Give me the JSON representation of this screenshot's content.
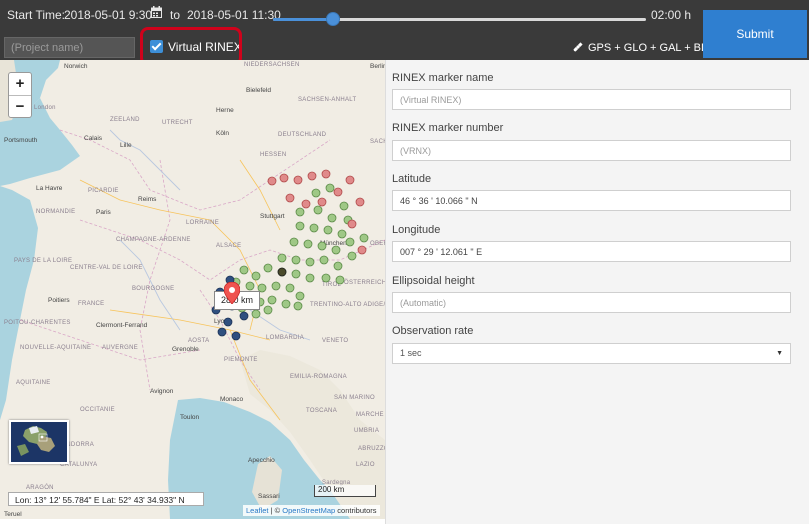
{
  "header": {
    "start_label": "Start Time:",
    "start_value": "2018-05-01 9:30",
    "to_label": "to",
    "end_value": "2018-05-01 11:30",
    "duration": "02:00 h",
    "slider_position": 0.16,
    "project_name_placeholder": "(Project name)",
    "virtual_rinex_label": "Virtual RINEX",
    "virtual_rinex_checked": true,
    "gnss_label": "GPS + GLO + GAL + BDS",
    "submit_label": "Submit",
    "accent": "#2f7fd0"
  },
  "map": {
    "zoom_in": "+",
    "zoom_out": "−",
    "marker_label": "28.0 km",
    "coordinates": "Lon: 13° 12' 55.784\" E Lat: 52° 43' 34.933\" N",
    "scale": "200 km",
    "attribution_leaflet": "Leaflet",
    "attribution_sep": " | © ",
    "attribution_osm": "OpenStreetMap",
    "attribution_rest": " contributors",
    "labels": [
      {
        "t": "Norwich"
      },
      {
        "t": "London"
      },
      {
        "t": "Portsmouth"
      },
      {
        "t": "Calais"
      },
      {
        "t": "Lille"
      },
      {
        "t": "ZEELAND"
      },
      {
        "t": "UTRECHT"
      },
      {
        "t": "Herne"
      },
      {
        "t": "Bielefeld"
      },
      {
        "t": "SACHSEN-ANHALT"
      },
      {
        "t": "Köln"
      },
      {
        "t": "DEUTSCHLAND"
      },
      {
        "t": "HESSEN"
      },
      {
        "t": "Reims"
      },
      {
        "t": "PICARDIE"
      },
      {
        "t": "La Havre"
      },
      {
        "t": "NORMANDIE"
      },
      {
        "t": "Paris"
      },
      {
        "t": "LORRAINE"
      },
      {
        "t": "Stuttgart"
      },
      {
        "t": "CHAMPAGNE-ARDENNE"
      },
      {
        "t": "ALSACE"
      },
      {
        "t": "München"
      },
      {
        "t": "PAYS DE LA LOIRE"
      },
      {
        "t": "CENTRE-VAL DE LOIRE"
      },
      {
        "t": "BOURGOGNE"
      },
      {
        "t": "TIROL"
      },
      {
        "t": "ÖSTERREICH"
      },
      {
        "t": "Poitiers"
      },
      {
        "t": "FRANCE"
      },
      {
        "t": "TRENTINO-ALTO ADIGE/SÜDTIROL"
      },
      {
        "t": "POITOU-CHARENTES"
      },
      {
        "t": "Clermont-Ferrand"
      },
      {
        "t": "Lyon"
      },
      {
        "t": "NOUVELLE-AQUITAINE"
      },
      {
        "t": "AUVERGNE"
      },
      {
        "t": "Grenoble"
      },
      {
        "t": "AOSTA"
      },
      {
        "t": "LOMBARDIA"
      },
      {
        "t": "VENETO"
      },
      {
        "t": "PIEMONTE"
      },
      {
        "t": "EMILIA-ROMAGNA"
      },
      {
        "t": "AQUITAINE"
      },
      {
        "t": "Avignon"
      },
      {
        "t": "Monaco"
      },
      {
        "t": "OCCITANIE"
      },
      {
        "t": "Toulon"
      },
      {
        "t": "TOSCANA"
      },
      {
        "t": "MARCHE"
      },
      {
        "t": "SAN MARINO"
      },
      {
        "t": "ANDORRA"
      },
      {
        "t": "CATALUNYA"
      },
      {
        "t": "ARAGÓN"
      },
      {
        "t": "Apecchio"
      },
      {
        "t": "LAZIO"
      },
      {
        "t": "Sassari"
      },
      {
        "t": "Teruel"
      },
      {
        "t": "Sardegna"
      },
      {
        "t": "Berlin"
      },
      {
        "t": "NIEDERSACHSEN"
      },
      {
        "t": "SACHS"
      },
      {
        "t": "OBERO"
      },
      {
        "t": "UMBRIA"
      },
      {
        "t": "ABRUZZO"
      }
    ]
  },
  "form": {
    "marker_name_label": "RINEX marker name",
    "marker_name_placeholder": "(Virtual RINEX)",
    "marker_number_label": "RINEX marker number",
    "marker_number_placeholder": "(VRNX)",
    "latitude_label": "Latitude",
    "latitude_value": "46 ° 36 ' 10.066 \" N",
    "longitude_label": "Longitude",
    "longitude_value": "007 ° 29 ' 12.061 \" E",
    "height_label": "Ellipsoidal height",
    "height_placeholder": "(Automatic)",
    "rate_label": "Observation rate",
    "rate_value": "1 sec"
  }
}
